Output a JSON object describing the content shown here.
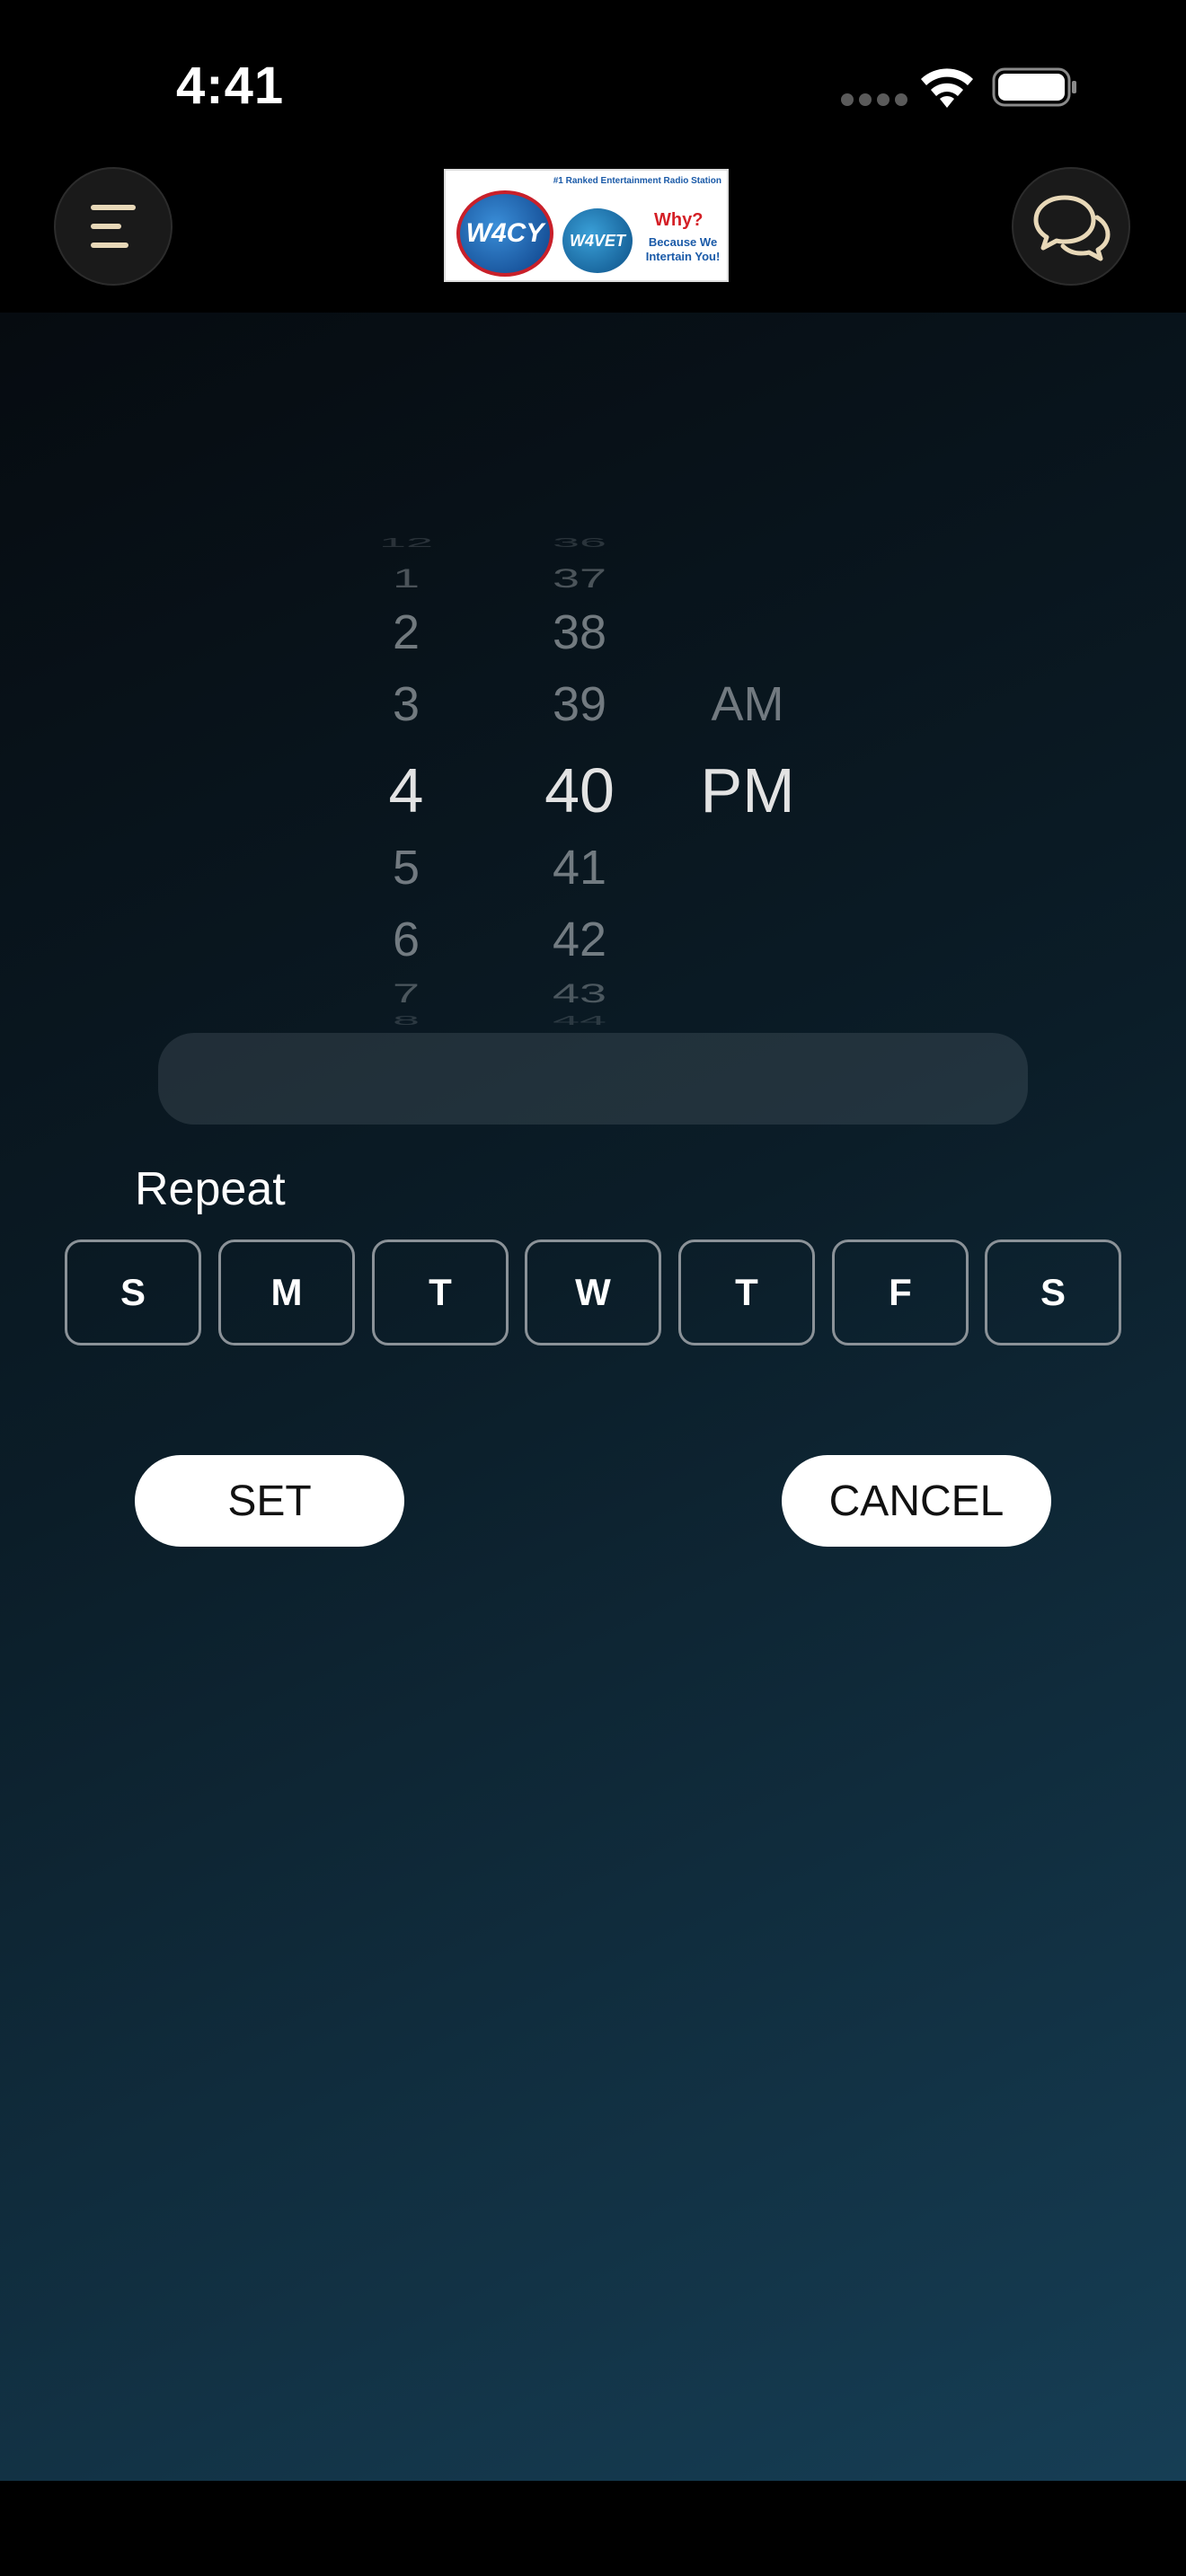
{
  "status_bar": {
    "time": "4:41"
  },
  "header": {
    "menu_icon": "menu-lines-icon",
    "chat_icon": "chat-bubbles-icon",
    "logo": {
      "tagline": "#1 Ranked Entertainment Radio Station",
      "brand_main": "W4CY",
      "brand_secondary": "W4VET",
      "why": "Why?",
      "because": "Because We Intertain You!"
    }
  },
  "picker": {
    "hours": {
      "selected": "4",
      "above": [
        "1",
        "2",
        "3"
      ],
      "below": [
        "5",
        "6",
        "7"
      ]
    },
    "minutes": {
      "selected": "40",
      "above": [
        "37",
        "38",
        "39"
      ],
      "below": [
        "41",
        "42",
        "43"
      ]
    },
    "ampm": {
      "selected": "PM",
      "above": [
        "AM"
      ]
    }
  },
  "repeat": {
    "label": "Repeat",
    "days": [
      "S",
      "M",
      "T",
      "W",
      "T",
      "F",
      "S"
    ]
  },
  "actions": {
    "set_label": "SET",
    "cancel_label": "CANCEL"
  },
  "colors": {
    "accent_icon": "#e8d8b8",
    "highlight": "#3a4450"
  }
}
